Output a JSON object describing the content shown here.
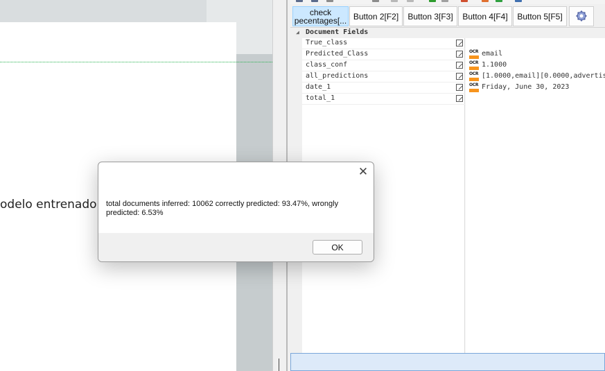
{
  "document_viewer": {
    "page_text": "odelo entrenado"
  },
  "toolbar": {
    "buttons": [
      {
        "label": "check\npecentages[...",
        "active": true
      },
      {
        "label": "Button 2[F2]"
      },
      {
        "label": "Button 3[F3]"
      },
      {
        "label": "Button 4[F4]"
      },
      {
        "label": "Button 5[F5]"
      }
    ],
    "settings_icon": "gear-icon"
  },
  "fields_panel": {
    "title": "Document Fields",
    "rows": [
      {
        "name": "True_class",
        "value": "",
        "ocr": false
      },
      {
        "name": "Predicted_Class",
        "value": "email",
        "ocr": true
      },
      {
        "name": "class_conf",
        "value": "1.1000",
        "ocr": true
      },
      {
        "name": "all_predictions",
        "value": "[1.0000,email][0.0000,advertis",
        "ocr": true
      },
      {
        "name": "date_1",
        "value": "Friday, June 30, 2023",
        "ocr": true
      },
      {
        "name": "total_1",
        "value": "",
        "ocr": false
      }
    ],
    "ocr_badge": "OCR",
    "accent_color": "#f7941d"
  },
  "dialog": {
    "message": "total documents inferred: 10062 correctly predicted: 93.47%, wrongly predicted: 6.53%",
    "ok_label": "OK"
  }
}
